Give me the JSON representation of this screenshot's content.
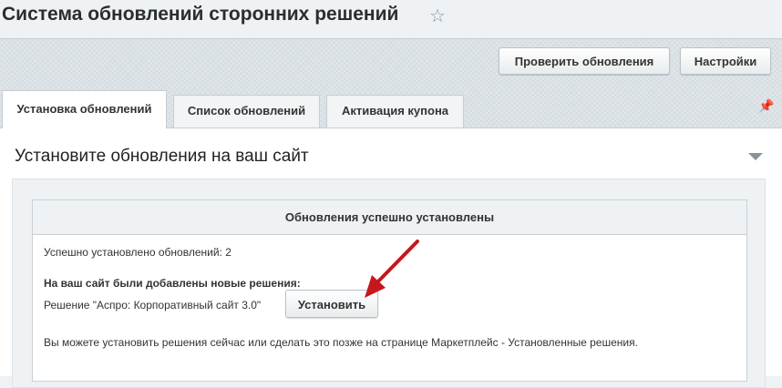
{
  "header": {
    "title": "Система обновлений сторонних решений",
    "star_icon": "star-icon"
  },
  "toolbar": {
    "check_updates_label": "Проверить обновления",
    "settings_label": "Настройки"
  },
  "tabs": [
    {
      "label": "Установка обновлений",
      "active": true
    },
    {
      "label": "Список обновлений",
      "active": false
    },
    {
      "label": "Активация купона",
      "active": false
    }
  ],
  "section": {
    "title": "Установите обновления на ваш сайт",
    "notice": {
      "header": "Обновления успешно установлены",
      "installed_count": "Успешно установлено обновлений: 2",
      "added_heading": "На ваш сайт были добавлены новые решения:",
      "solution_text": "Решение \"Аспро: Корпоративный сайт 3.0\"",
      "install_label": "Установить",
      "info_text": "Вы можете установить решения сейчас или сделать это позже на странице Маркетплейс - Установленные решения."
    }
  },
  "colors": {
    "arrow": "#c8161d",
    "background": "#eef2f4"
  }
}
